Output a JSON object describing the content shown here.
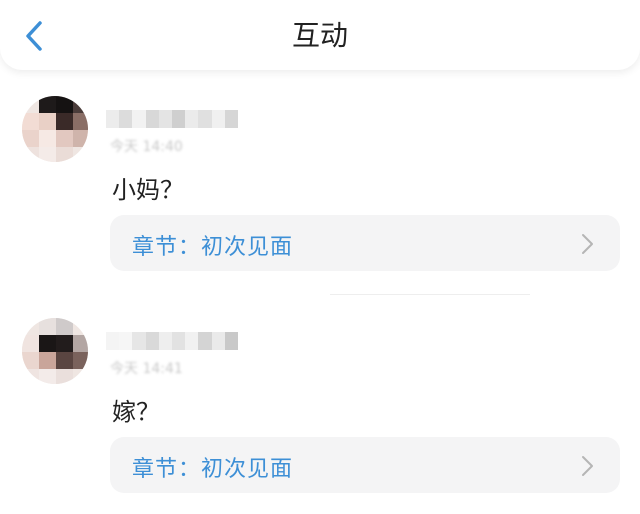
{
  "header": {
    "title": "互动",
    "back_icon": "chevron-left-icon",
    "accent_color": "#3d8fd6"
  },
  "comments": [
    {
      "time": "今天 14:40",
      "text": "小妈？",
      "chapter_label": "章节：初次见面"
    },
    {
      "time": "今天 14:41",
      "text": "嫁？",
      "chapter_label": "章节：初次见面"
    }
  ]
}
